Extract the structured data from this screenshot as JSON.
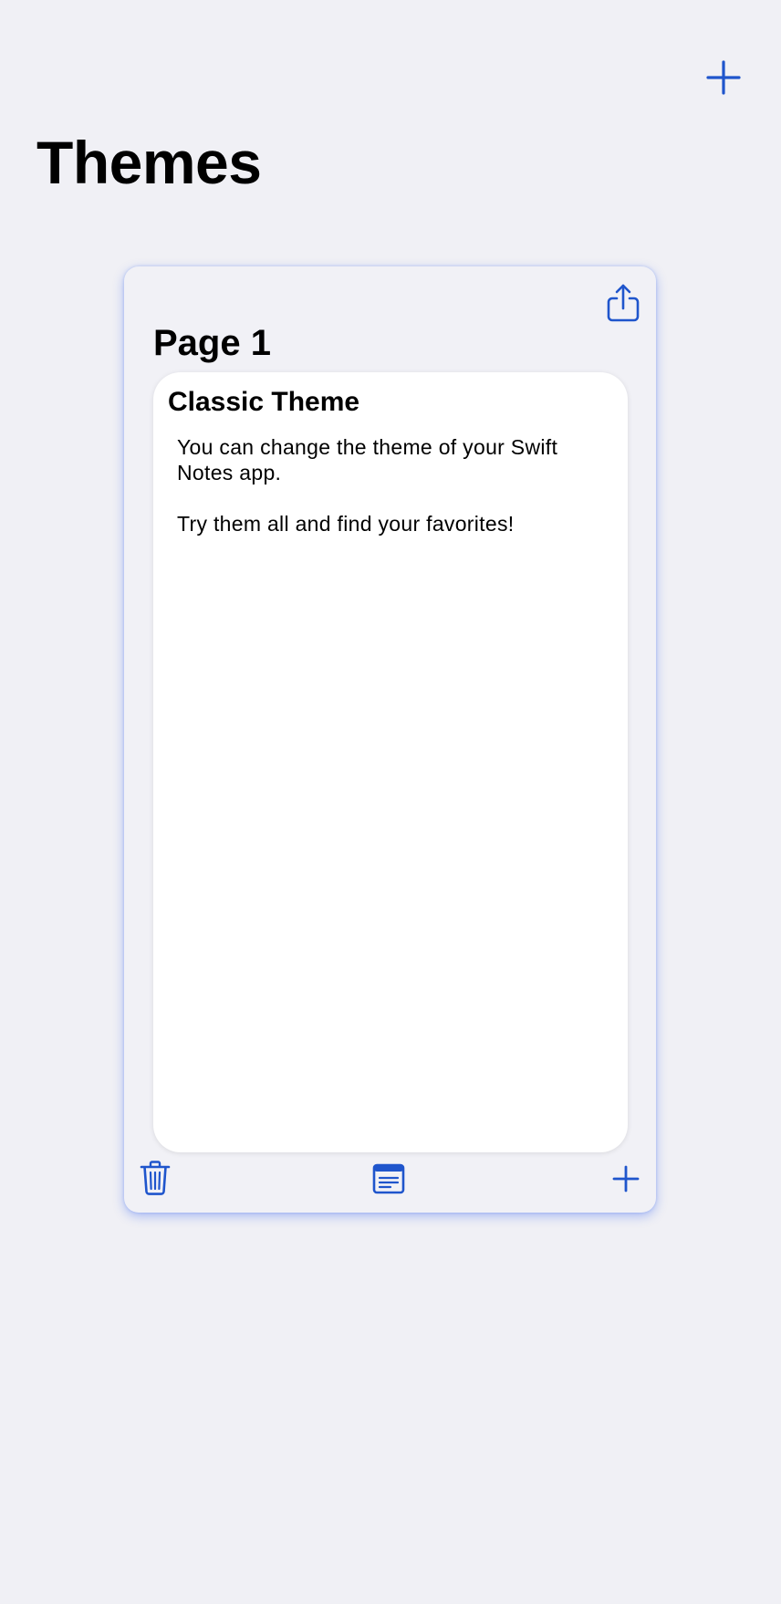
{
  "colors": {
    "background": "#f0f0f5",
    "accent": "#1f55cc",
    "card_shadow": "#2a5af0",
    "note_background": "#ffffff"
  },
  "header": {
    "title": "Themes",
    "add_icon": "plus-icon"
  },
  "card": {
    "page_title": "Page 1",
    "share_icon": "share-icon",
    "note": {
      "title": "Classic Theme",
      "paragraphs": [
        "You can change the theme of your Swift Notes app.",
        "Try them all and find your favorites!"
      ]
    },
    "toolbar": {
      "left_icon": "trash-icon",
      "center_icon": "note-list-icon",
      "right_icon": "plus-icon"
    }
  }
}
